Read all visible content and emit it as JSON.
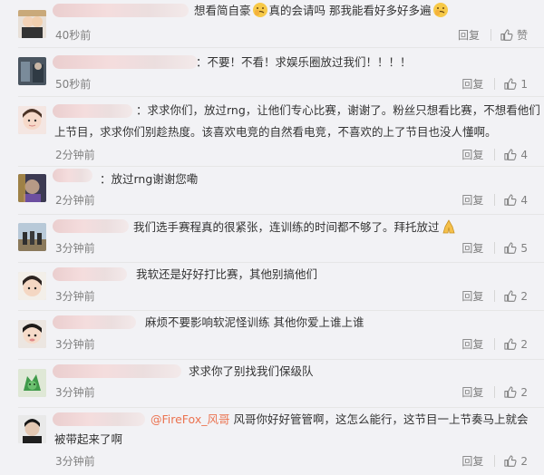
{
  "comments": [
    {
      "text_before": "想看简自豪",
      "text_mid": "真的会请吗 那我能看好多好多遍",
      "time": "40秒前",
      "reply": "回复",
      "like": "赞"
    },
    {
      "text": "：不要！不看！求娱乐圈放过我们！！！！",
      "time": "50秒前",
      "reply": "回复",
      "like": "1"
    },
    {
      "text_line1": "：求求你们，放过rng，让他们专心比赛，谢谢了。粉丝只想看比赛，不想看他们",
      "text_line2": "上节目，求求你们别趁热度。该喜欢电竞的自然看电竞，不喜欢的上了节目也没人懂啊。",
      "time": "2分钟前",
      "reply": "回复",
      "like": "4"
    },
    {
      "text": "：放过rng谢谢您嘞",
      "time": "2分钟前",
      "reply": "回复",
      "like": "4"
    },
    {
      "text": "我们选手赛程真的很紧张，连训练的时间都不够了。拜托放过",
      "time": "3分钟前",
      "reply": "回复",
      "like": "5"
    },
    {
      "text": "我软还是好好打比赛，其他别搞他们",
      "time": "3分钟前",
      "reply": "回复",
      "like": "2"
    },
    {
      "text": "麻烦不要影响软泥怪训练 其他你爱上谁上谁",
      "time": "3分钟前",
      "reply": "回复",
      "like": "2"
    },
    {
      "text": "求求你了别找我们保级队",
      "time": "3分钟前",
      "reply": "回复",
      "like": "2"
    },
    {
      "mention": "@FireFox_风哥",
      "text_line1": " 风哥你好好管管啊，这怎么能行，这节目一上节奏马上就会",
      "text_line2": "被带起来了啊",
      "time": "3分钟前",
      "reply": "回复",
      "like": "2"
    }
  ],
  "icons": {
    "like": "thumbs-up-icon",
    "emoji": "facepalm-emoji-icon",
    "emoji2": "folded-hands-emoji-icon"
  },
  "colors": {
    "mention": "#eb7350",
    "meta": "#808080"
  }
}
